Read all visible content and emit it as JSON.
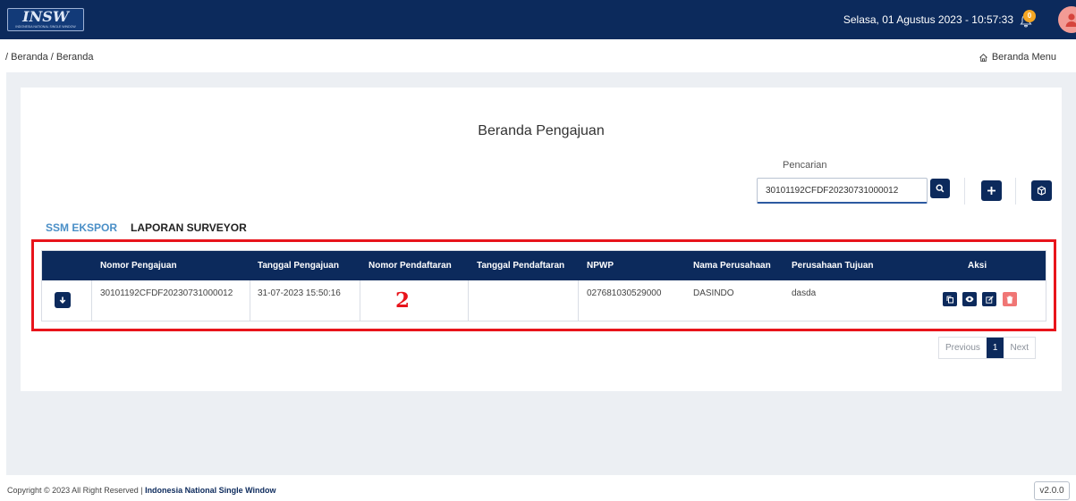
{
  "header": {
    "logo_text": "INSW",
    "logo_subtitle": "INDONESIA NATIONAL SINGLE WINDOW",
    "datetime": "Selasa, 01 Agustus 2023 - 10:57:33",
    "notification_count": "0",
    "brand_color": "#0c2a5c"
  },
  "breadcrumb": {
    "path": "/ Beranda / Beranda",
    "menu_link": "Beranda Menu"
  },
  "main": {
    "title": "Beranda Pengajuan",
    "search": {
      "label": "Pencarian",
      "value": "30101192CFDF20230731000012"
    },
    "tabs": [
      {
        "label": "SSM EKSPOR",
        "active": true
      },
      {
        "label": "LAPORAN SURVEYOR",
        "active": false
      }
    ],
    "table": {
      "columns": [
        "Nomor Pengajuan",
        "Tanggal Pengajuan",
        "Nomor Pendaftaran",
        "Tanggal Pendaftaran",
        "NPWP",
        "Nama Perusahaan",
        "Perusahaan Tujuan",
        "Aksi"
      ],
      "rows": [
        {
          "nomor_pengajuan": "30101192CFDF20230731000012",
          "tanggal_pengajuan": "31-07-2023 15:50:16",
          "nomor_pendaftaran": "",
          "tanggal_pendaftaran": "",
          "npwp": "027681030529000",
          "nama_perusahaan": "DASINDO",
          "perusahaan_tujuan": "dasda"
        }
      ]
    },
    "annotation": "2",
    "annotation_color": "#e8141b",
    "pagination": {
      "previous": "Previous",
      "current": "1",
      "next": "Next"
    }
  },
  "footer": {
    "copyright_prefix": "Copyright © 2023 All Right Reserved |",
    "copyright_org": "Indonesia National Single Window",
    "version": "v2.0.0"
  }
}
